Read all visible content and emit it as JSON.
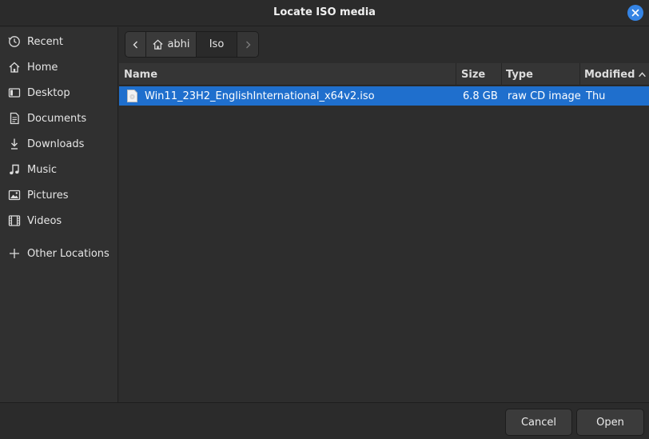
{
  "window": {
    "title": "Locate ISO media"
  },
  "sidebar": {
    "items": [
      {
        "label": "Recent",
        "icon": "clock-icon"
      },
      {
        "label": "Home",
        "icon": "home-icon"
      },
      {
        "label": "Desktop",
        "icon": "desktop-icon"
      },
      {
        "label": "Documents",
        "icon": "document-icon"
      },
      {
        "label": "Downloads",
        "icon": "download-icon"
      },
      {
        "label": "Music",
        "icon": "music-icon"
      },
      {
        "label": "Pictures",
        "icon": "picture-icon"
      },
      {
        "label": "Videos",
        "icon": "video-icon"
      },
      {
        "label": "Other Locations",
        "icon": "plus-icon"
      }
    ]
  },
  "pathbar": {
    "segments": [
      "abhi",
      "Iso"
    ]
  },
  "filelist": {
    "columns": {
      "name": "Name",
      "size": "Size",
      "type": "Type",
      "modified": "Modified"
    },
    "sort": {
      "column": "Modified",
      "direction": "ascending"
    },
    "rows": [
      {
        "name": "Win11_23H2_EnglishInternational_x64v2.iso",
        "size": "6.8 GB",
        "type": "raw CD image",
        "modified": "Thu",
        "selected": true
      }
    ]
  },
  "actions": {
    "cancel": "Cancel",
    "open": "Open"
  },
  "colors": {
    "accent": "#3584e4",
    "selection": "#1f6fcd",
    "background": "#2d2d2d"
  }
}
